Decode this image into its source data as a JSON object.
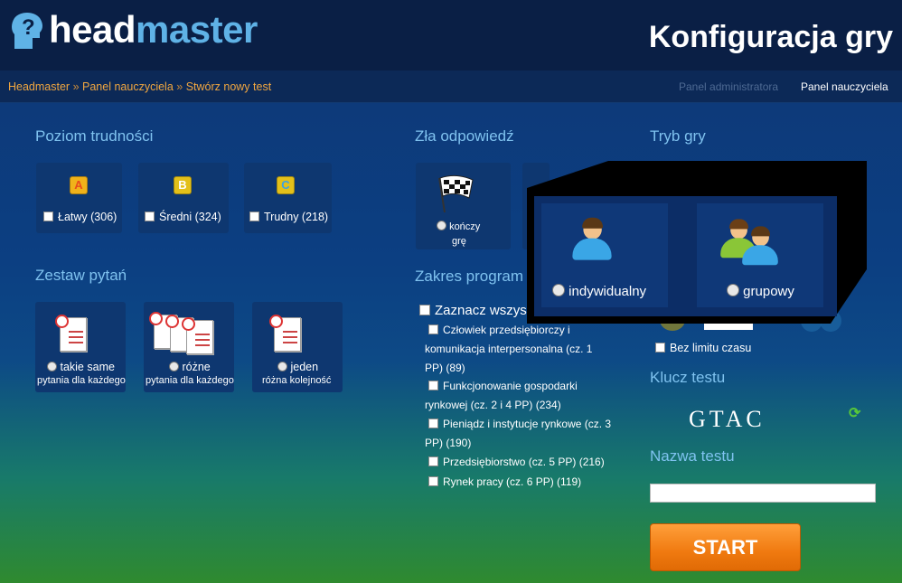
{
  "header": {
    "logo_text_1": "head",
    "logo_text_2": "master",
    "page_title": "Konfiguracja gry"
  },
  "breadcrumb": {
    "items": [
      "Headmaster",
      "Panel nauczyciela",
      "Stwórz nowy test"
    ],
    "sep": "»"
  },
  "top_nav": {
    "admin": "Panel administratora",
    "teacher": "Panel nauczyciela"
  },
  "difficulty": {
    "heading": "Poziom trudności",
    "levels": [
      {
        "icon": "A",
        "label": "Łatwy (306)",
        "color": "#e84a1c"
      },
      {
        "icon": "B",
        "label": "Średni (324)",
        "color": "#e3c01a"
      },
      {
        "icon": "C",
        "label": "Trudny (218)",
        "color": "#3aa2e6"
      }
    ]
  },
  "question_set": {
    "heading": "Zestaw pytań",
    "options": [
      {
        "line1": "takie same",
        "line2": "pytania dla każdego"
      },
      {
        "line1": "różne",
        "line2": "pytania dla każdego"
      },
      {
        "line1": "jeden",
        "line2": "różna kolejność"
      }
    ]
  },
  "wrong_answer": {
    "heading": "Zła odpowiedź",
    "option_line1": "kończy",
    "option_line2": "grę"
  },
  "scope": {
    "heading": "Zakres program",
    "select_all": "Zaznacz wszys",
    "items": [
      {
        "l1": "Człowiek przedsiębiorczy i",
        "l2": "komunikacja interpersonalna (cz. 1",
        "l3": "PP) (89)"
      },
      {
        "l1": "Funkcjonowanie gospodarki",
        "l2": "rynkowej (cz. 2 i 4 PP) (234)"
      },
      {
        "l1": "Pieniądz i instytucje rynkowe (cz. 3",
        "l2": "PP) (190)"
      },
      {
        "l1": "Przedsiębiorstwo (cz. 5 PP) (216)"
      },
      {
        "l1": "Rynek pracy (cz. 6 PP) (119)"
      }
    ]
  },
  "game_mode": {
    "heading": "Tryb gry",
    "individual": "indywidualny",
    "group": "grupowy"
  },
  "time": {
    "no_limit": "Bez limitu czasu"
  },
  "test_key": {
    "heading": "Klucz testu",
    "value": "GTAC"
  },
  "test_name": {
    "heading": "Nazwa testu",
    "value": ""
  },
  "start_label": "START"
}
